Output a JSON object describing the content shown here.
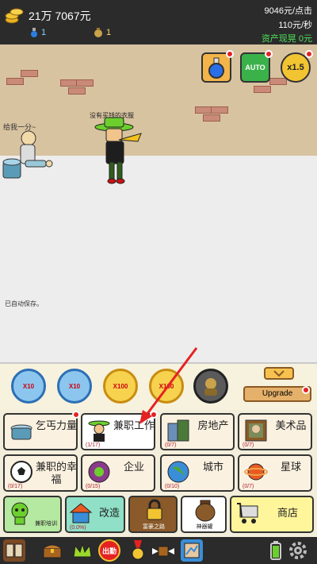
{
  "stats": {
    "money": "21万 7067元",
    "potion_count": "1",
    "bag_count": "1",
    "per_click": "9046元/点击",
    "per_sec": "110元/秒",
    "assets_label": "资产现晃",
    "assets_value": "0元"
  },
  "scene": {
    "beggar_speech": "给我一分~",
    "player_caption": "没有买钱的衣服",
    "autosave": "已自动保存。",
    "auto_label": "AUTO",
    "multiplier_label": "x1.5"
  },
  "skills": [
    {
      "label": "X10"
    },
    {
      "label": "X10"
    },
    {
      "label": "X100"
    },
    {
      "label": "X100"
    }
  ],
  "upgrade_label": "Upgrade",
  "grid": {
    "row1": [
      {
        "label": "乞丐力量",
        "count": ""
      },
      {
        "label": "兼职工作",
        "count": "(1/17)"
      },
      {
        "label": "房地产",
        "count": "(0/7)"
      },
      {
        "label": "美术品",
        "count": "(0/7)"
      }
    ],
    "row2": [
      {
        "label": "兼职的幸福",
        "count": "(0/17)"
      },
      {
        "label": "企业",
        "count": "(0/15)"
      },
      {
        "label": "城市",
        "count": "(0/10)"
      },
      {
        "label": "星球",
        "count": "(0/7)"
      }
    ],
    "row3": [
      {
        "label": "兼职培训",
        "count": ""
      },
      {
        "label": "改造",
        "count": "(0.0%)"
      },
      {
        "label": "富豪之路",
        "count": ""
      },
      {
        "label": "神器罐",
        "count": ""
      },
      {
        "label": "商店",
        "count": ""
      }
    ]
  },
  "bottom": {
    "attendance_label": "出勤"
  },
  "colors": {
    "topbar": "#2b2b2b",
    "assets_green": "#4ee05a",
    "wall": "#d8c3a0",
    "brick": "#c98b78",
    "red_dot": "#e52222",
    "skill_blue": "#8cc6ee",
    "skill_gold": "#f6d24e"
  }
}
